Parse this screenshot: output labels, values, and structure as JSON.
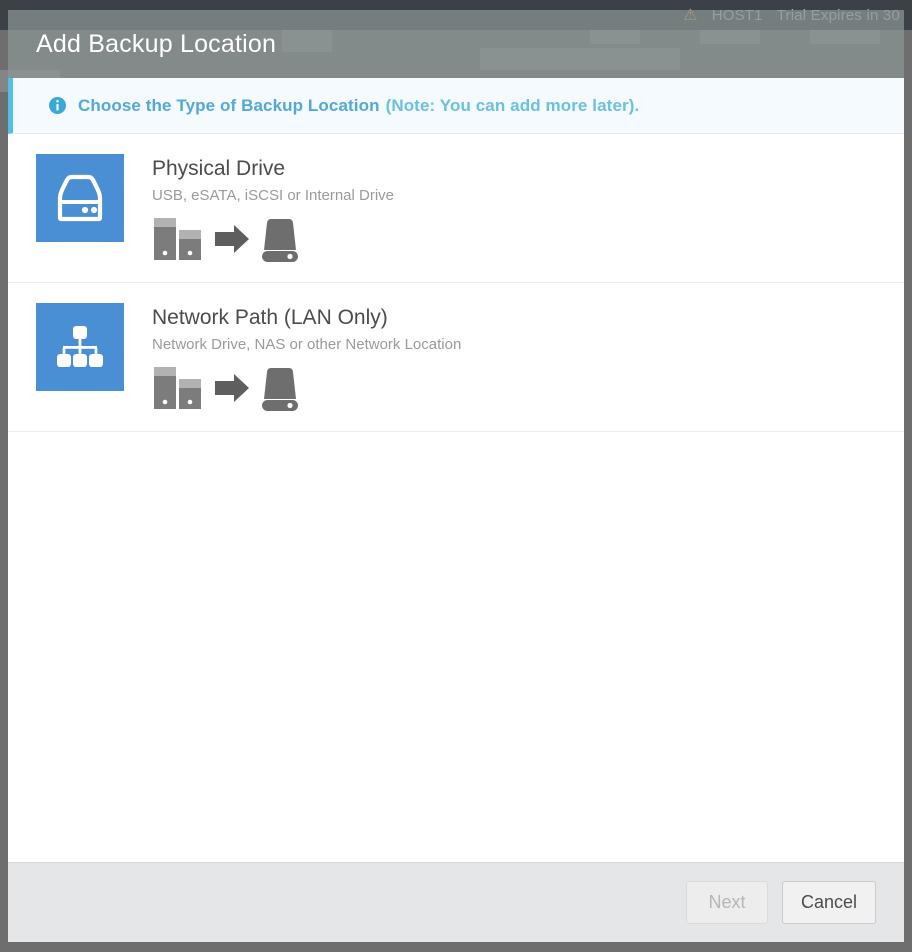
{
  "background": {
    "topbar_items": [
      {
        "icon": "warning-icon",
        "label": "⚠"
      },
      {
        "icon": "server-icon",
        "label": "HOST1"
      },
      {
        "icon": null,
        "label": "Trial Expires in 30"
      }
    ]
  },
  "modal": {
    "title": "Add Backup Location",
    "banner": {
      "icon": "info-icon",
      "text": "Choose the Type of Backup Location",
      "note": "(Note: You can add more later)."
    },
    "options": [
      {
        "tile_icon": "hard-drive-icon",
        "title": "Physical Drive",
        "subtitle": "USB, eSATA, iSCSI or Internal Drive",
        "illustration": "servers-to-external-drive-icon"
      },
      {
        "tile_icon": "network-sitemap-icon",
        "title": "Network Path (LAN Only)",
        "subtitle": "Network Drive, NAS or other Network Location",
        "illustration": "servers-to-external-drive-icon"
      }
    ],
    "footer": {
      "next_label": "Next",
      "next_disabled": true,
      "cancel_label": "Cancel"
    }
  },
  "colors": {
    "accent_blue": "#4a8fd4",
    "banner_border": "#52c0e5",
    "banner_text": "#52a9d8",
    "header_overlay": "rgba(140,150,150,0.72)",
    "footer_bg": "#e4e6e8",
    "illustration_gray": "#6e6e6e"
  }
}
